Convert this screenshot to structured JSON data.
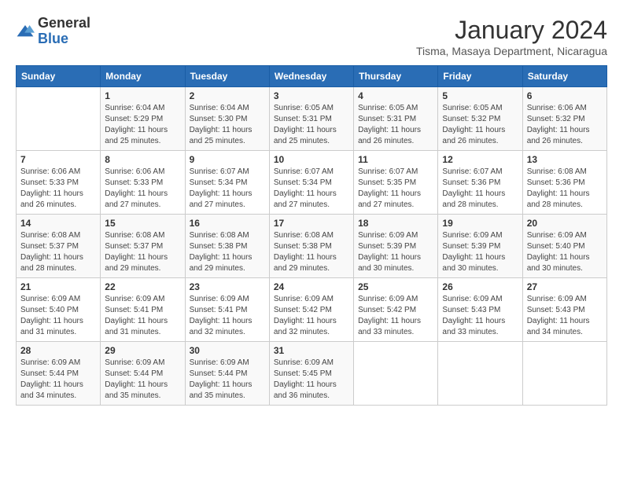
{
  "logo": {
    "text_general": "General",
    "text_blue": "Blue"
  },
  "header": {
    "month": "January 2024",
    "location": "Tisma, Masaya Department, Nicaragua"
  },
  "weekdays": [
    "Sunday",
    "Monday",
    "Tuesday",
    "Wednesday",
    "Thursday",
    "Friday",
    "Saturday"
  ],
  "weeks": [
    [
      {
        "day": "",
        "info": ""
      },
      {
        "day": "1",
        "info": "Sunrise: 6:04 AM\nSunset: 5:29 PM\nDaylight: 11 hours\nand 25 minutes."
      },
      {
        "day": "2",
        "info": "Sunrise: 6:04 AM\nSunset: 5:30 PM\nDaylight: 11 hours\nand 25 minutes."
      },
      {
        "day": "3",
        "info": "Sunrise: 6:05 AM\nSunset: 5:31 PM\nDaylight: 11 hours\nand 25 minutes."
      },
      {
        "day": "4",
        "info": "Sunrise: 6:05 AM\nSunset: 5:31 PM\nDaylight: 11 hours\nand 26 minutes."
      },
      {
        "day": "5",
        "info": "Sunrise: 6:05 AM\nSunset: 5:32 PM\nDaylight: 11 hours\nand 26 minutes."
      },
      {
        "day": "6",
        "info": "Sunrise: 6:06 AM\nSunset: 5:32 PM\nDaylight: 11 hours\nand 26 minutes."
      }
    ],
    [
      {
        "day": "7",
        "info": "Sunrise: 6:06 AM\nSunset: 5:33 PM\nDaylight: 11 hours\nand 26 minutes."
      },
      {
        "day": "8",
        "info": "Sunrise: 6:06 AM\nSunset: 5:33 PM\nDaylight: 11 hours\nand 27 minutes."
      },
      {
        "day": "9",
        "info": "Sunrise: 6:07 AM\nSunset: 5:34 PM\nDaylight: 11 hours\nand 27 minutes."
      },
      {
        "day": "10",
        "info": "Sunrise: 6:07 AM\nSunset: 5:34 PM\nDaylight: 11 hours\nand 27 minutes."
      },
      {
        "day": "11",
        "info": "Sunrise: 6:07 AM\nSunset: 5:35 PM\nDaylight: 11 hours\nand 27 minutes."
      },
      {
        "day": "12",
        "info": "Sunrise: 6:07 AM\nSunset: 5:36 PM\nDaylight: 11 hours\nand 28 minutes."
      },
      {
        "day": "13",
        "info": "Sunrise: 6:08 AM\nSunset: 5:36 PM\nDaylight: 11 hours\nand 28 minutes."
      }
    ],
    [
      {
        "day": "14",
        "info": "Sunrise: 6:08 AM\nSunset: 5:37 PM\nDaylight: 11 hours\nand 28 minutes."
      },
      {
        "day": "15",
        "info": "Sunrise: 6:08 AM\nSunset: 5:37 PM\nDaylight: 11 hours\nand 29 minutes."
      },
      {
        "day": "16",
        "info": "Sunrise: 6:08 AM\nSunset: 5:38 PM\nDaylight: 11 hours\nand 29 minutes."
      },
      {
        "day": "17",
        "info": "Sunrise: 6:08 AM\nSunset: 5:38 PM\nDaylight: 11 hours\nand 29 minutes."
      },
      {
        "day": "18",
        "info": "Sunrise: 6:09 AM\nSunset: 5:39 PM\nDaylight: 11 hours\nand 30 minutes."
      },
      {
        "day": "19",
        "info": "Sunrise: 6:09 AM\nSunset: 5:39 PM\nDaylight: 11 hours\nand 30 minutes."
      },
      {
        "day": "20",
        "info": "Sunrise: 6:09 AM\nSunset: 5:40 PM\nDaylight: 11 hours\nand 30 minutes."
      }
    ],
    [
      {
        "day": "21",
        "info": "Sunrise: 6:09 AM\nSunset: 5:40 PM\nDaylight: 11 hours\nand 31 minutes."
      },
      {
        "day": "22",
        "info": "Sunrise: 6:09 AM\nSunset: 5:41 PM\nDaylight: 11 hours\nand 31 minutes."
      },
      {
        "day": "23",
        "info": "Sunrise: 6:09 AM\nSunset: 5:41 PM\nDaylight: 11 hours\nand 32 minutes."
      },
      {
        "day": "24",
        "info": "Sunrise: 6:09 AM\nSunset: 5:42 PM\nDaylight: 11 hours\nand 32 minutes."
      },
      {
        "day": "25",
        "info": "Sunrise: 6:09 AM\nSunset: 5:42 PM\nDaylight: 11 hours\nand 33 minutes."
      },
      {
        "day": "26",
        "info": "Sunrise: 6:09 AM\nSunset: 5:43 PM\nDaylight: 11 hours\nand 33 minutes."
      },
      {
        "day": "27",
        "info": "Sunrise: 6:09 AM\nSunset: 5:43 PM\nDaylight: 11 hours\nand 34 minutes."
      }
    ],
    [
      {
        "day": "28",
        "info": "Sunrise: 6:09 AM\nSunset: 5:44 PM\nDaylight: 11 hours\nand 34 minutes."
      },
      {
        "day": "29",
        "info": "Sunrise: 6:09 AM\nSunset: 5:44 PM\nDaylight: 11 hours\nand 35 minutes."
      },
      {
        "day": "30",
        "info": "Sunrise: 6:09 AM\nSunset: 5:44 PM\nDaylight: 11 hours\nand 35 minutes."
      },
      {
        "day": "31",
        "info": "Sunrise: 6:09 AM\nSunset: 5:45 PM\nDaylight: 11 hours\nand 36 minutes."
      },
      {
        "day": "",
        "info": ""
      },
      {
        "day": "",
        "info": ""
      },
      {
        "day": "",
        "info": ""
      }
    ]
  ]
}
